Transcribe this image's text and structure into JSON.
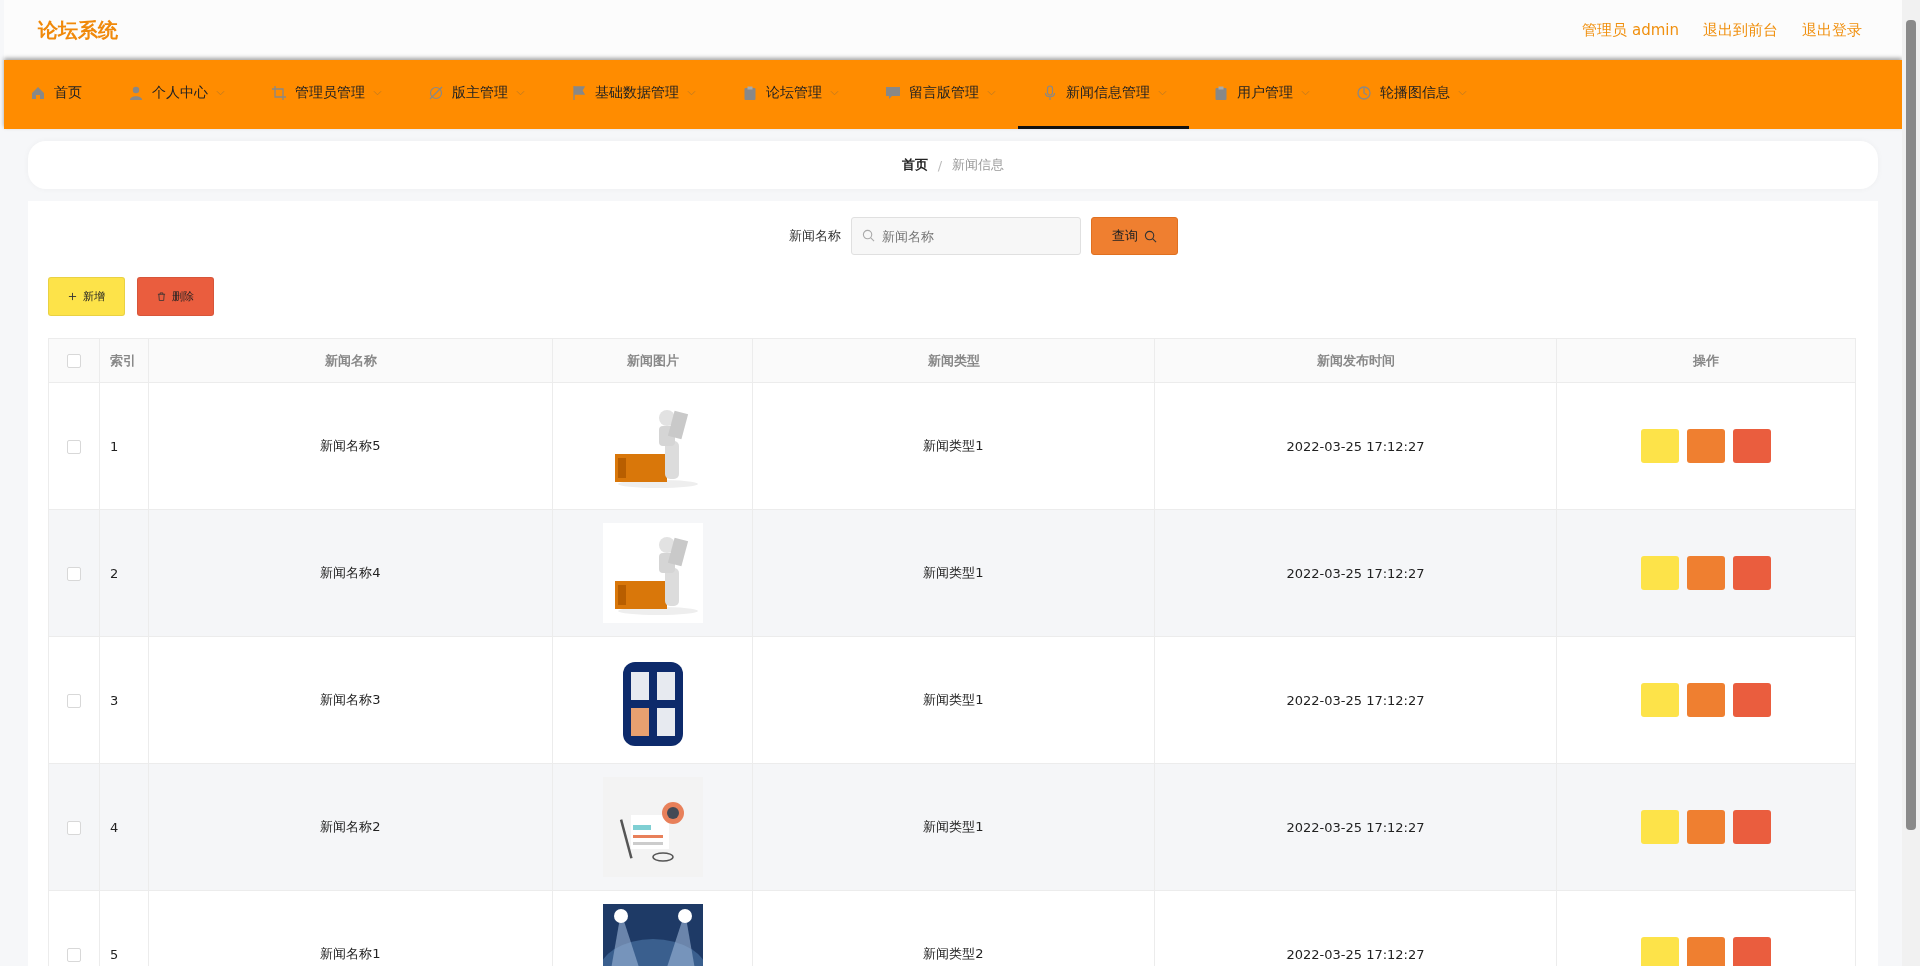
{
  "app_title": "论坛系统",
  "header_links": [
    "管理员 admin",
    "退出到前台",
    "退出登录"
  ],
  "nav": [
    {
      "label": "首页",
      "kind": "home",
      "has_menu": false,
      "selected": false
    },
    {
      "label": "个人中心",
      "kind": "person",
      "has_menu": true,
      "selected": false
    },
    {
      "label": "管理员管理",
      "kind": "crop",
      "has_menu": true,
      "selected": false
    },
    {
      "label": "版主管理",
      "kind": "slash",
      "has_menu": true,
      "selected": false
    },
    {
      "label": "基础数据管理",
      "kind": "flag",
      "has_menu": true,
      "selected": false
    },
    {
      "label": "论坛管理",
      "kind": "clipboard",
      "has_menu": true,
      "selected": false
    },
    {
      "label": "留言版管理",
      "kind": "chat",
      "has_menu": true,
      "selected": false
    },
    {
      "label": "新闻信息管理",
      "kind": "mic",
      "has_menu": true,
      "selected": true
    },
    {
      "label": "用户管理",
      "kind": "clipboard",
      "has_menu": true,
      "selected": false
    },
    {
      "label": "轮播图信息",
      "kind": "clock",
      "has_menu": true,
      "selected": false
    }
  ],
  "breadcrumb": [
    {
      "label": "首页",
      "current": false
    },
    {
      "label": "新闻信息",
      "current": true
    }
  ],
  "breadcrumb_separator": "/",
  "search": {
    "label": "新闻名称",
    "placeholder": "新闻名称",
    "button": "查询"
  },
  "actions": [
    {
      "label": "新增",
      "kind": "add"
    },
    {
      "label": "删除",
      "kind": "delete"
    }
  ],
  "table": {
    "select_all_checked": false,
    "columns": [
      "索引",
      "新闻名称",
      "新闻图片",
      "新闻类型",
      "新闻发布时间",
      "操作"
    ],
    "row_actions": [
      {
        "kind": "primary"
      },
      {
        "kind": "secondary"
      },
      {
        "kind": "danger"
      }
    ],
    "rows": [
      {
        "checked": false,
        "index": "1",
        "name": "新闻名称5",
        "type": "新闻类型1",
        "time": "2022-03-25 17:12:27"
      },
      {
        "checked": false,
        "index": "2",
        "name": "新闻名称4",
        "type": "新闻类型1",
        "time": "2022-03-25 17:12:27"
      },
      {
        "checked": false,
        "index": "3",
        "name": "新闻名称3",
        "type": "新闻类型1",
        "time": "2022-03-25 17:12:27"
      },
      {
        "checked": false,
        "index": "4",
        "name": "新闻名称2",
        "type": "新闻类型1",
        "time": "2022-03-25 17:12:27"
      },
      {
        "checked": false,
        "index": "5",
        "name": "新闻名称1",
        "type": "新闻类型2",
        "time": "2022-03-25 17:12:27"
      }
    ]
  }
}
